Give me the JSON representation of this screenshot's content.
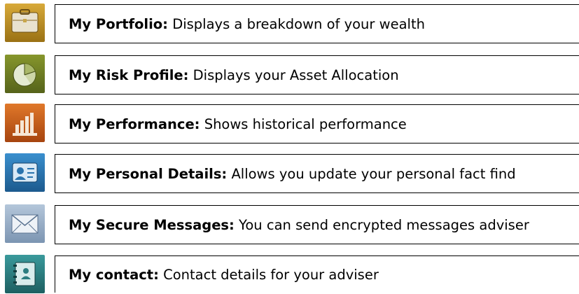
{
  "menu": {
    "items": [
      {
        "title": "My Portfolio:",
        "description": "Displays a breakdown of your wealth",
        "icon": "briefcase-icon",
        "color": "#b5891f"
      },
      {
        "title": "My Risk Profile:",
        "description": "Displays your Asset Allocation",
        "icon": "pie-chart-icon",
        "color": "#6c7a22"
      },
      {
        "title": "My Performance:",
        "description": "Shows historical performance",
        "icon": "bar-chart-icon",
        "color": "#c45a1a"
      },
      {
        "title": "My Personal Details:",
        "description": "Allows you update your personal fact find",
        "icon": "contact-card-icon",
        "color": "#2a73ad"
      },
      {
        "title": "My Secure Messages:",
        "description": "You can send encrypted messages adviser",
        "icon": "envelope-icon",
        "color": "#93aac4"
      },
      {
        "title": "My contact:",
        "description": "Contact details for your adviser",
        "icon": "address-book-icon",
        "color": "#2c7d80"
      }
    ]
  }
}
